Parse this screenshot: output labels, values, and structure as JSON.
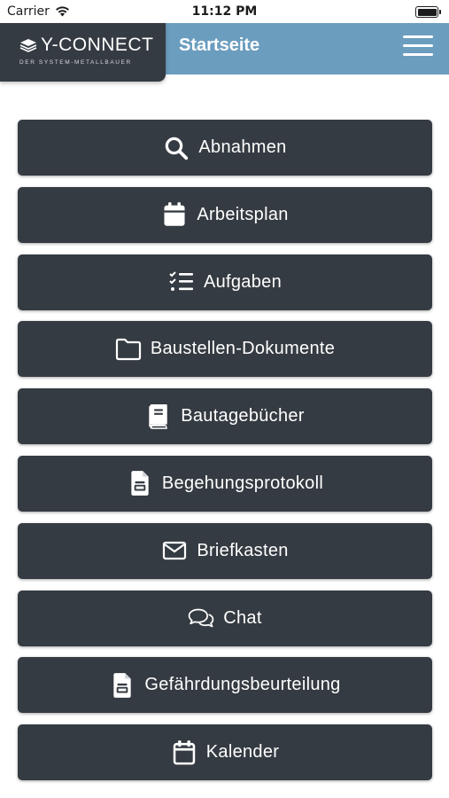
{
  "status_bar": {
    "carrier": "Carrier",
    "time": "11:12 PM"
  },
  "header": {
    "logo": {
      "name": "Y-CONNECT",
      "tagline": "DER SYSTEM-METALLBAUER"
    },
    "title": "Startseite",
    "colors": {
      "bar": "#6b9dbf",
      "logo_box": "#353b42"
    }
  },
  "menu": {
    "button_color": "#353b42",
    "items": [
      {
        "label": "Abnahmen",
        "icon": "search-icon"
      },
      {
        "label": "Arbeitsplan",
        "icon": "calendar-filled-icon"
      },
      {
        "label": "Aufgaben",
        "icon": "task-list-icon"
      },
      {
        "label": "Baustellen-Dokumente",
        "icon": "folder-icon"
      },
      {
        "label": "Bautagebücher",
        "icon": "book-icon"
      },
      {
        "label": "Begehungsprotokoll",
        "icon": "document-icon"
      },
      {
        "label": "Briefkasten",
        "icon": "envelope-icon"
      },
      {
        "label": "Chat",
        "icon": "chat-icon"
      },
      {
        "label": "Gefährdungsbeurteilung",
        "icon": "document-icon"
      },
      {
        "label": "Kalender",
        "icon": "calendar-outline-icon"
      }
    ]
  }
}
